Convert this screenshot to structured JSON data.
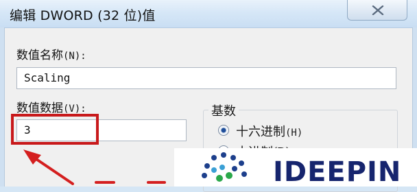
{
  "window": {
    "title": "编辑 DWORD (32 位)值",
    "close_icon": "close-icon"
  },
  "value_name": {
    "label_text": "数值名称",
    "label_key": "(N):",
    "value": "Scaling"
  },
  "value_data": {
    "label_text": "数值数据",
    "label_key": "(V):",
    "value": "3"
  },
  "base": {
    "title": "基数",
    "options": [
      {
        "label_text": "十六进制",
        "label_key": "(H)",
        "selected": true
      },
      {
        "label_text": "十进制",
        "label_key": "(D)",
        "selected": false
      }
    ]
  },
  "annotation": {
    "highlight_color": "#c8191b"
  },
  "watermark": {
    "text": "IDEEPIN"
  },
  "colors": {
    "titlebar": "#d6e7f7",
    "client": "#f0f0f0",
    "accent": "#1f4e9a",
    "watermark_text": "#16256e"
  }
}
